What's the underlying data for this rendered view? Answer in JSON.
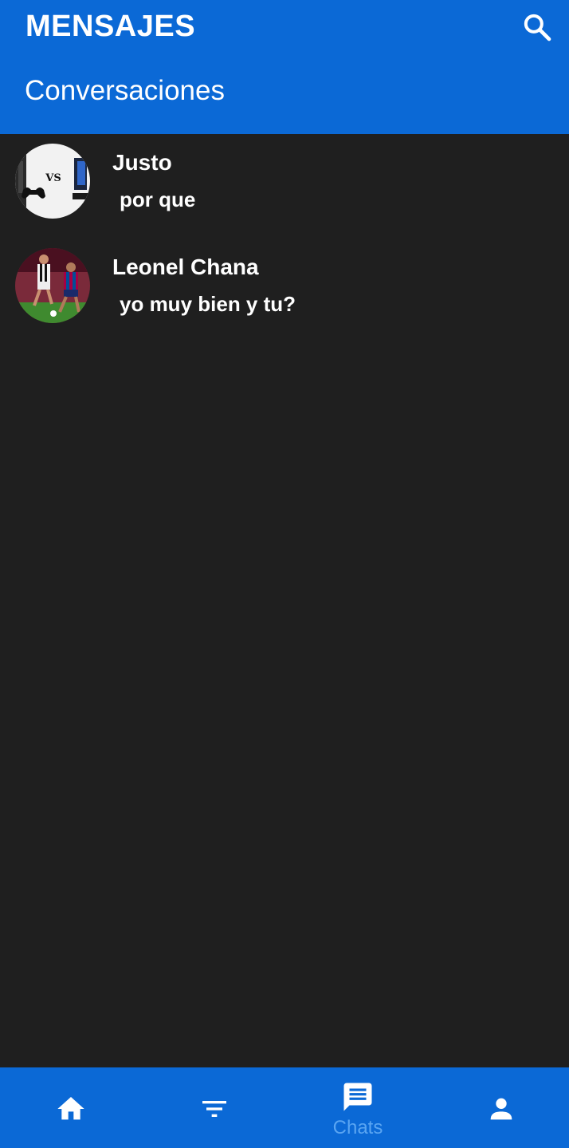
{
  "header": {
    "title": "MENSAJES",
    "subtitle": "Conversaciones",
    "search_icon": "search-icon"
  },
  "chats": [
    {
      "name": "Justo",
      "last_message": "por que",
      "avatar": "console-vs-pc-avatar"
    },
    {
      "name": "Leonel Chana",
      "last_message": "yo muy bien y tu?",
      "avatar": "football-players-avatar"
    }
  ],
  "avatar_text": {
    "vs": "VS"
  },
  "bottom_nav": {
    "items": [
      {
        "id": "home",
        "icon": "home-icon",
        "label": ""
      },
      {
        "id": "filter",
        "icon": "filter-icon",
        "label": ""
      },
      {
        "id": "chats",
        "icon": "chat-icon",
        "label": "Chats",
        "active": true
      },
      {
        "id": "profile",
        "icon": "person-icon",
        "label": ""
      }
    ]
  },
  "colors": {
    "primary": "#0b69d6",
    "background": "#1f1f1f",
    "active_label": "#5aa5f2",
    "text": "#ffffff"
  }
}
